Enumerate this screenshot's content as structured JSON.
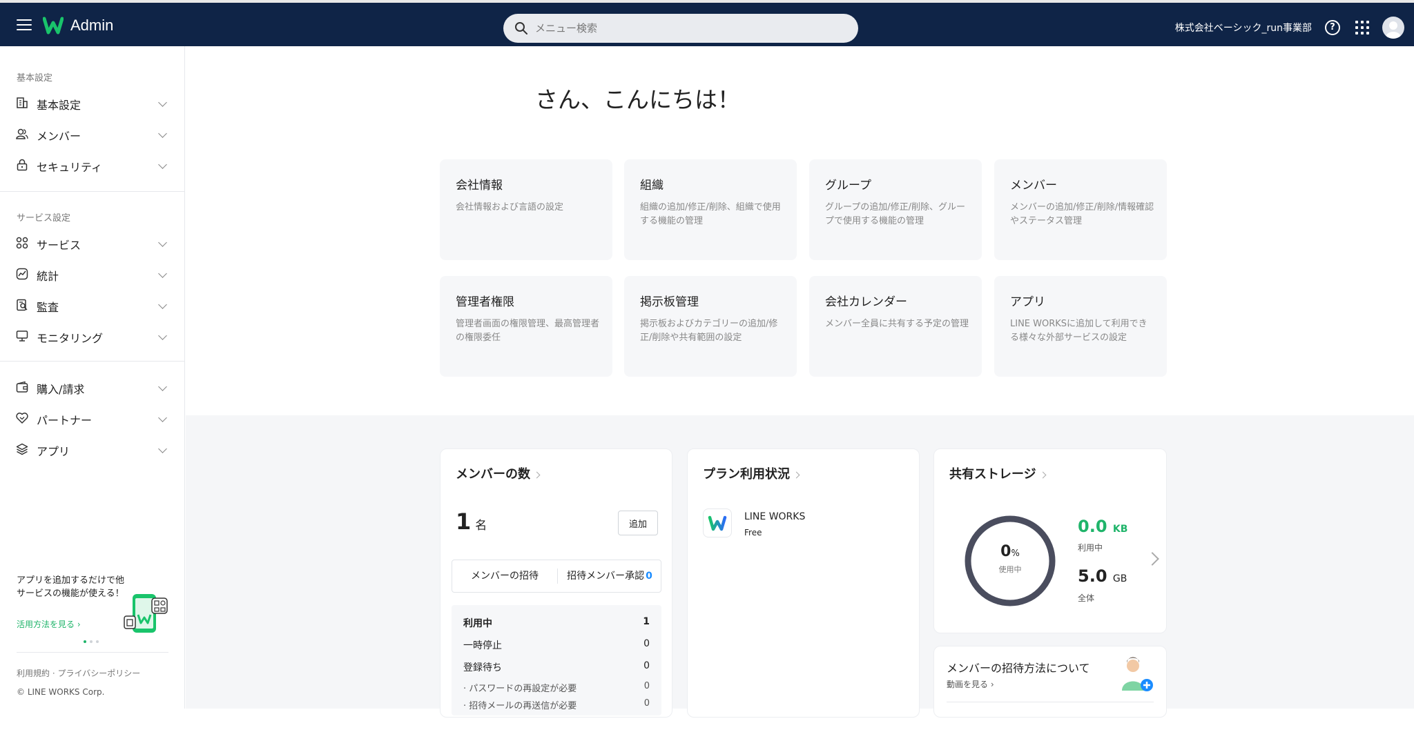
{
  "header": {
    "app_title": "Admin",
    "search_placeholder": "メニュー検索",
    "org_name": "株式会社ベーシック_run事業部",
    "help_label": "?"
  },
  "sidebar": {
    "section_basic": "基本設定",
    "section_service": "サービス設定",
    "items": [
      {
        "label": "基本設定",
        "icon": "building-icon"
      },
      {
        "label": "メンバー",
        "icon": "members-icon"
      },
      {
        "label": "セキュリティ",
        "icon": "lock-icon"
      },
      {
        "label": "サービス",
        "icon": "grid-icon"
      },
      {
        "label": "統計",
        "icon": "chart-icon"
      },
      {
        "label": "監査",
        "icon": "audit-icon"
      },
      {
        "label": "モニタリング",
        "icon": "monitor-icon"
      },
      {
        "label": "購入/請求",
        "icon": "wallet-icon"
      },
      {
        "label": "パートナー",
        "icon": "handshake-icon"
      },
      {
        "label": "アプリ",
        "icon": "stack-icon"
      }
    ],
    "promo_text": "アプリを追加するだけで他サービスの機能が使える！",
    "promo_link": "活用方法を見る ›",
    "footer_terms": "利用規約",
    "footer_sep": " · ",
    "footer_privacy": "プライバシーポリシー",
    "copyright": "© LINE WORKS Corp."
  },
  "main": {
    "greeting": "さん、こんにちは！",
    "cards": [
      {
        "title": "会社情報",
        "desc": "会社情報および言語の設定"
      },
      {
        "title": "組織",
        "desc": "組織の追加/修正/削除、組織で使用する機能の管理"
      },
      {
        "title": "グループ",
        "desc": "グループの追加/修正/削除、グループで使用する機能の管理"
      },
      {
        "title": "メンバー",
        "desc": "メンバーの追加/修正/削除/情報確認やステータス管理"
      },
      {
        "title": "管理者権限",
        "desc": "管理者画面の権限管理、最高管理者の権限委任"
      },
      {
        "title": "掲示板管理",
        "desc": "掲示板およびカテゴリーの追加/修正/削除や共有範囲の設定"
      },
      {
        "title": "会社カレンダー",
        "desc": "メンバー全員に共有する予定の管理"
      },
      {
        "title": "アプリ",
        "desc": "LINE WORKSに追加して利用できる様々な外部サービスの設定"
      }
    ]
  },
  "members_panel": {
    "title": "メンバーの数",
    "count": "1",
    "unit": "名",
    "add_label": "追加",
    "invite_label": "メンバーの招待",
    "approval_label": "招待メンバー承認",
    "approval_count": "0",
    "rows": [
      {
        "label": "利用中",
        "value": "1"
      },
      {
        "label": "一時停止",
        "value": "0"
      },
      {
        "label": "登録待ち",
        "value": "0"
      },
      {
        "label": "· パスワードの再設定が必要",
        "value": "0"
      },
      {
        "label": "· 招待メールの再送信が必要",
        "value": "0"
      }
    ]
  },
  "plan_panel": {
    "title": "プラン利用状況",
    "plan_name": "LINE WORKS",
    "plan_tier": "Free"
  },
  "storage_panel": {
    "title": "共有ストレージ",
    "percent": "0",
    "percent_unit": "%",
    "percent_label": "使用中",
    "usage_fraction": 0,
    "used_value": "0.0",
    "used_unit": "KB",
    "used_label": "利用中",
    "total_value": "5.0",
    "total_unit": "GB",
    "total_label": "全体"
  },
  "invite_panel": {
    "title": "メンバーの招待方法について",
    "link": "動画を見る ›"
  },
  "colors": {
    "header_bg": "#0f2447",
    "accent_green": "#1fb46a",
    "accent_blue": "#1a8cff",
    "donut_ring": "#4a4d5e"
  }
}
